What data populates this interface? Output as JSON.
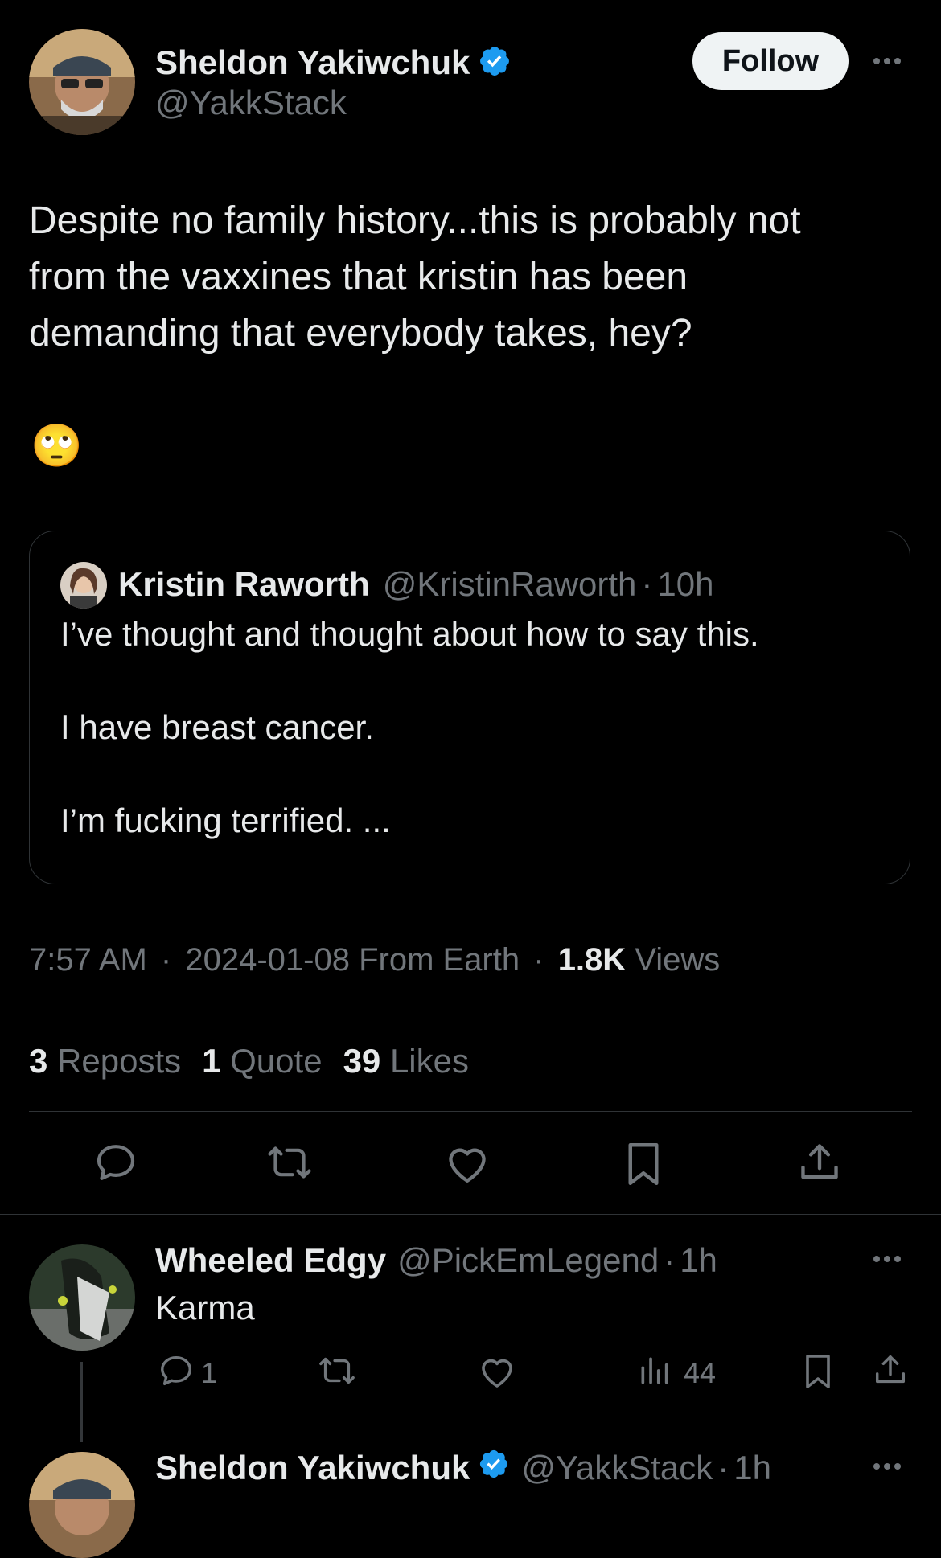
{
  "tweet": {
    "author_name": "Sheldon Yakiwchuk",
    "author_handle": "@YakkStack",
    "follow_label": "Follow",
    "text": "Despite no family history...this is probably not\nfrom the vaxxines that kristin has been\ndemanding that everybody takes, hey?",
    "emoji": "🙄",
    "time": "7:57 AM",
    "sep1": "·",
    "date_source": "2024-01-08 From Earth",
    "sep2": "·",
    "views_count": "1.8K",
    "views_label": "Views"
  },
  "quoted": {
    "author_name": "Kristin Raworth",
    "author_handle": "@KristinRaworth",
    "sep": "·",
    "age": "10h",
    "line1": "I’ve thought and thought about how to say this.",
    "line2": "I have breast cancer.",
    "line3": "I’m fucking terrified. ..."
  },
  "stats": {
    "reposts_count": "3",
    "reposts_label": "Reposts",
    "quote_count": "1",
    "quote_label": "Quote",
    "likes_count": "39",
    "likes_label": "Likes"
  },
  "actions": [
    "reply-icon",
    "repost-icon",
    "like-icon",
    "bookmark-icon",
    "share-icon"
  ],
  "reply": {
    "author_name": "Wheeled Edgy",
    "author_handle": "@PickEmLegend",
    "sep": "·",
    "age": "1h",
    "text": "Karma",
    "reply_count": "1",
    "views_count": "44"
  },
  "next_reply": {
    "author_name": "Sheldon Yakiwchuk",
    "author_handle": "@YakkStack",
    "sep": "·",
    "age": "1h"
  },
  "colors": {
    "background": "#000000",
    "text": "#e7e9ea",
    "secondary": "#71767b",
    "verified": "#1d9bf0",
    "divider": "#2f3336"
  }
}
